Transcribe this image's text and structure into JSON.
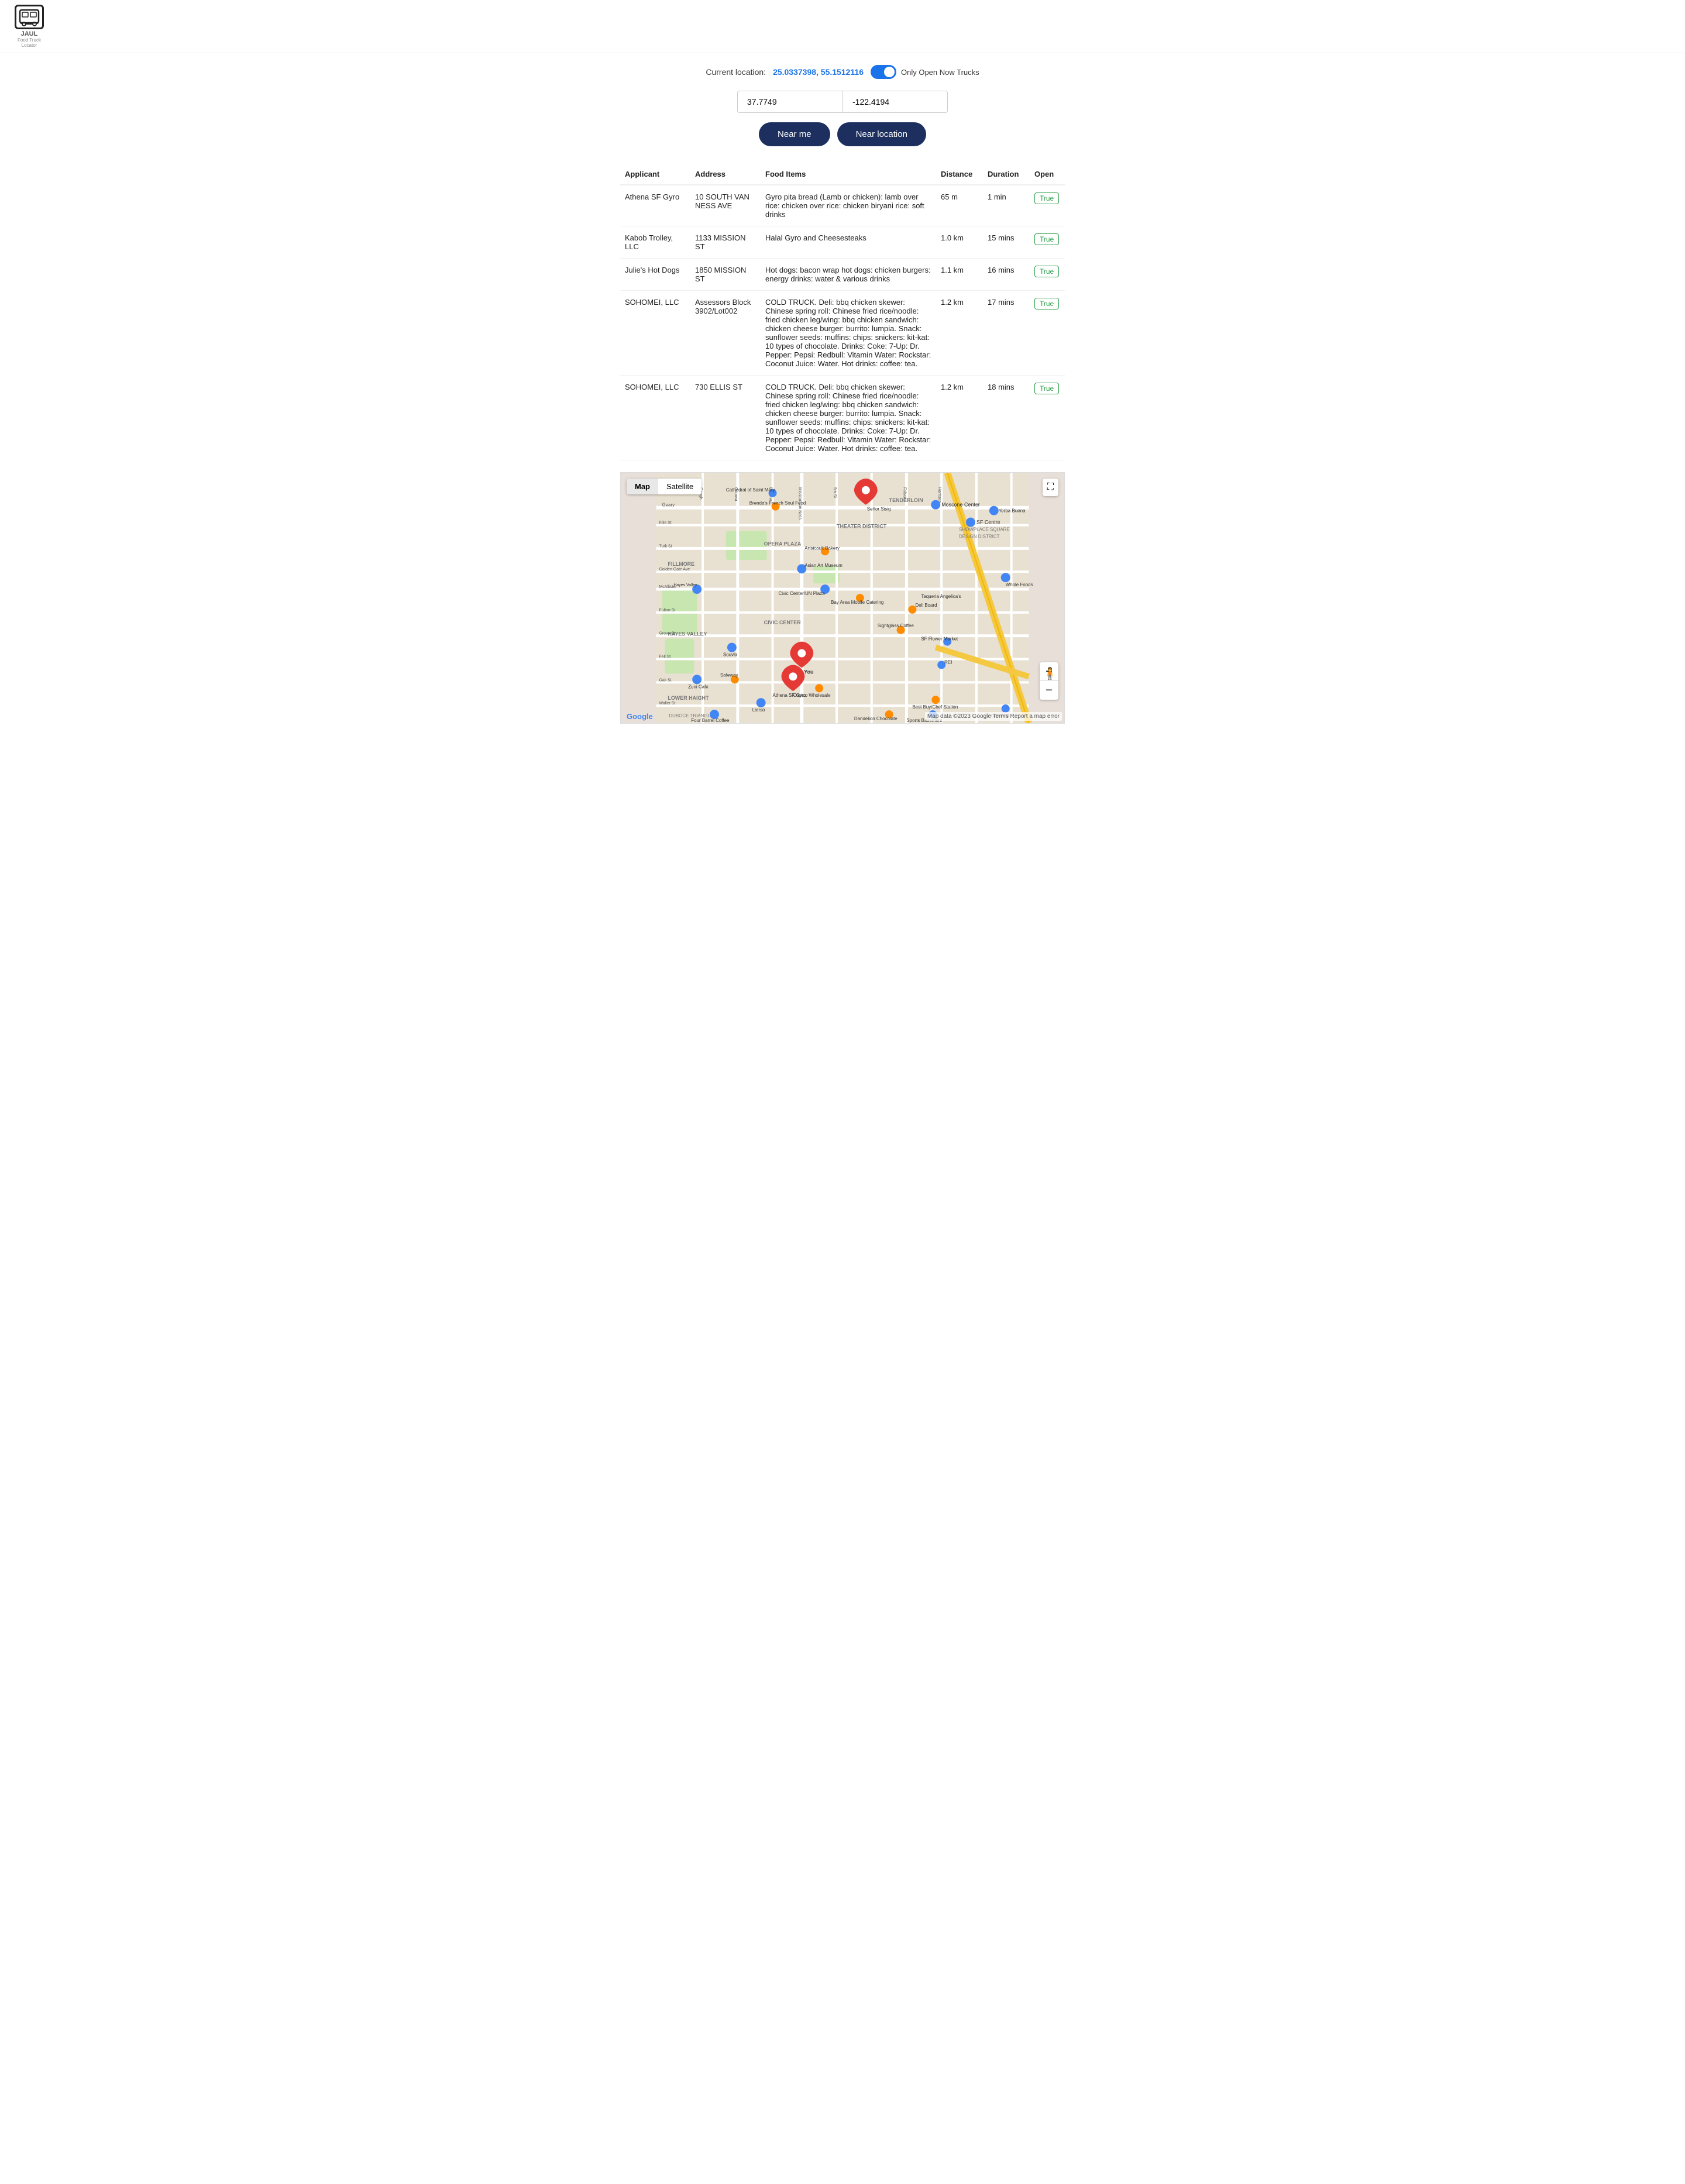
{
  "logo": {
    "icon": "🚌",
    "title": "JAUL",
    "subtitle": "Food Truck Locator"
  },
  "header": {
    "current_location_label": "Current location:",
    "current_location_value": "25.0337398, 55.1512116",
    "toggle_label": "Only Open Now Trucks",
    "toggle_on": true
  },
  "inputs": {
    "latitude": "37.7749",
    "longitude": "-122.4194"
  },
  "buttons": {
    "near_me": "Near me",
    "near_location": "Near location"
  },
  "table": {
    "headers": {
      "applicant": "Applicant",
      "address": "Address",
      "food_items": "Food Items",
      "distance": "Distance",
      "duration": "Duration",
      "open": "Open"
    },
    "rows": [
      {
        "applicant": "Athena SF Gyro",
        "address": "10 SOUTH VAN NESS AVE",
        "food_items": "Gyro pita bread (Lamb or chicken): lamb over rice: chicken over rice: chicken biryani rice: soft drinks",
        "distance": "65 m",
        "duration": "1 min",
        "open": "True"
      },
      {
        "applicant": "Kabob Trolley, LLC",
        "address": "1133 MISSION ST",
        "food_items": "Halal Gyro and Cheesesteaks",
        "distance": "1.0 km",
        "duration": "15 mins",
        "open": "True"
      },
      {
        "applicant": "Julie's Hot Dogs",
        "address": "1850 MISSION ST",
        "food_items": "Hot dogs: bacon wrap hot dogs: chicken burgers: energy drinks: water & various drinks",
        "distance": "1.1 km",
        "duration": "16 mins",
        "open": "True"
      },
      {
        "applicant": "SOHOMEI, LLC",
        "address": "Assessors Block 3902/Lot002",
        "food_items": "COLD TRUCK. Deli: bbq chicken skewer: Chinese spring roll: Chinese fried rice/noodle: fried chicken leg/wing: bbq chicken sandwich: chicken cheese burger: burrito: lumpia. Snack: sunflower seeds: muffins: chips: snickers: kit-kat: 10 types of chocolate. Drinks: Coke: 7-Up: Dr. Pepper: Pepsi: Redbull: Vitamin Water: Rockstar: Coconut Juice: Water. Hot drinks: coffee: tea.",
        "distance": "1.2 km",
        "duration": "17 mins",
        "open": "True"
      },
      {
        "applicant": "SOHOMEI, LLC",
        "address": "730 ELLIS ST",
        "food_items": "COLD TRUCK. Deli: bbq chicken skewer: Chinese spring roll: Chinese fried rice/noodle: fried chicken leg/wing: bbq chicken sandwich: chicken cheese burger: burrito: lumpia. Snack: sunflower seeds: muffins: chips: snickers: kit-kat: 10 types of chocolate. Drinks: Coke: 7-Up: Dr. Pepper: Pepsi: Redbull: Vitamin Water: Rockstar: Coconut Juice: Water. Hot drinks: coffee: tea.",
        "distance": "1.2 km",
        "duration": "18 mins",
        "open": "True"
      }
    ]
  },
  "map": {
    "type_label": "Map",
    "satellite_label": "Satellite",
    "fullscreen_icon": "⛶",
    "zoom_in": "+",
    "zoom_out": "−",
    "attribution": "Map data ©2023 Google  Terms  Report a map error",
    "google_logo": "Google"
  }
}
